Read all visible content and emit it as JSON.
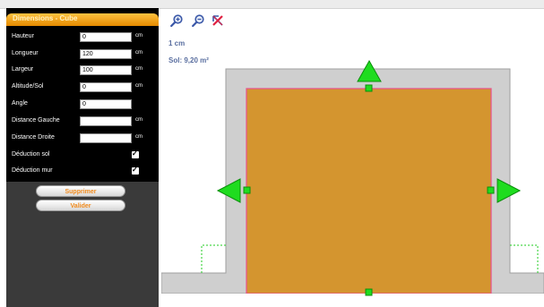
{
  "panel": {
    "title": "Dimensions - Cube",
    "fields": [
      {
        "label": "Hauteur",
        "value": "0",
        "unit": "cm"
      },
      {
        "label": "Longueur",
        "value": "120",
        "unit": "cm"
      },
      {
        "label": "Largeur",
        "value": "100",
        "unit": "cm"
      },
      {
        "label": "Altitude/Sol",
        "value": "0",
        "unit": "cm"
      },
      {
        "label": "Angle",
        "value": "0",
        "unit": ""
      },
      {
        "label": "Distance Gauche",
        "value": "",
        "unit": "cm"
      },
      {
        "label": "Distance Droite",
        "value": "",
        "unit": "cm"
      }
    ],
    "checks": [
      {
        "label": "Déduction sol",
        "checked": true
      },
      {
        "label": "Déduction mur",
        "checked": true
      }
    ],
    "buttons": {
      "delete_label": "Supprimer",
      "validate_label": "Valider"
    }
  },
  "toolbar": {
    "icons": [
      "zoom-in-icon",
      "zoom-out-icon",
      "reset-view-icon"
    ]
  },
  "canvas": {
    "scale_label": "1 cm",
    "area_label": "Sol: 9,20 m²"
  },
  "colors": {
    "header": "#f39c12",
    "cube_fill": "#d4952f",
    "wall": "#cfcfcf",
    "handle": "#1fdc1f",
    "text_blue": "#5a6fa0"
  }
}
